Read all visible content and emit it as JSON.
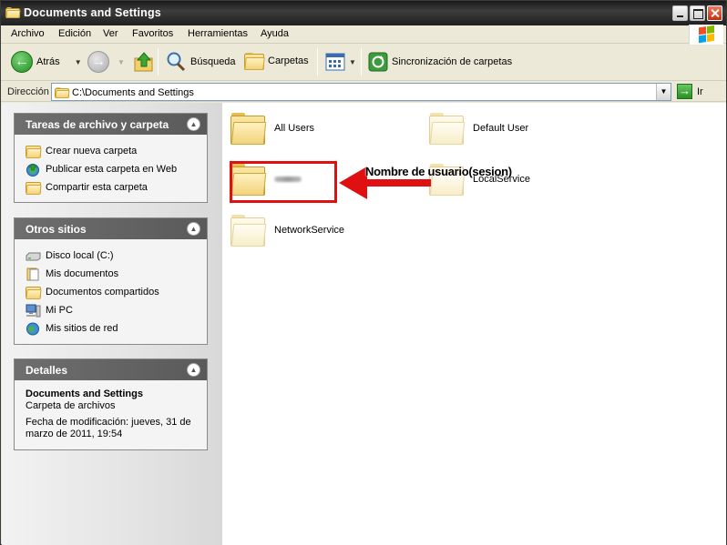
{
  "window": {
    "title": "Documents and Settings"
  },
  "menubar": {
    "items": [
      "Archivo",
      "Edición",
      "Ver",
      "Favoritos",
      "Herramientas",
      "Ayuda"
    ]
  },
  "toolbar": {
    "back_label": "Atrás",
    "search_label": "Búsqueda",
    "folders_label": "Carpetas",
    "sync_label": "Sincronización de carpetas"
  },
  "address": {
    "label": "Dirección",
    "value": "C:\\Documents and Settings",
    "go_label": "Ir"
  },
  "sidebar": {
    "tasks": {
      "title": "Tareas de archivo y carpeta",
      "items": [
        "Crear nueva carpeta",
        "Publicar esta carpeta en Web",
        "Compartir esta carpeta"
      ]
    },
    "places": {
      "title": "Otros sitios",
      "items": [
        "Disco local (C:)",
        "Mis documentos",
        "Documentos compartidos",
        "Mi PC",
        "Mis sitios de red"
      ]
    },
    "details": {
      "title": "Detalles",
      "name": "Documents and Settings",
      "type": "Carpeta de archivos",
      "modified": "Fecha de modificación: jueves, 31 de marzo de 2011, 19:54"
    }
  },
  "folders": [
    "All Users",
    "Default User",
    "LocalService",
    "NetworkService"
  ],
  "annotation": {
    "text": "Nombre de usuario(sesion)",
    "color": "#e01010"
  }
}
